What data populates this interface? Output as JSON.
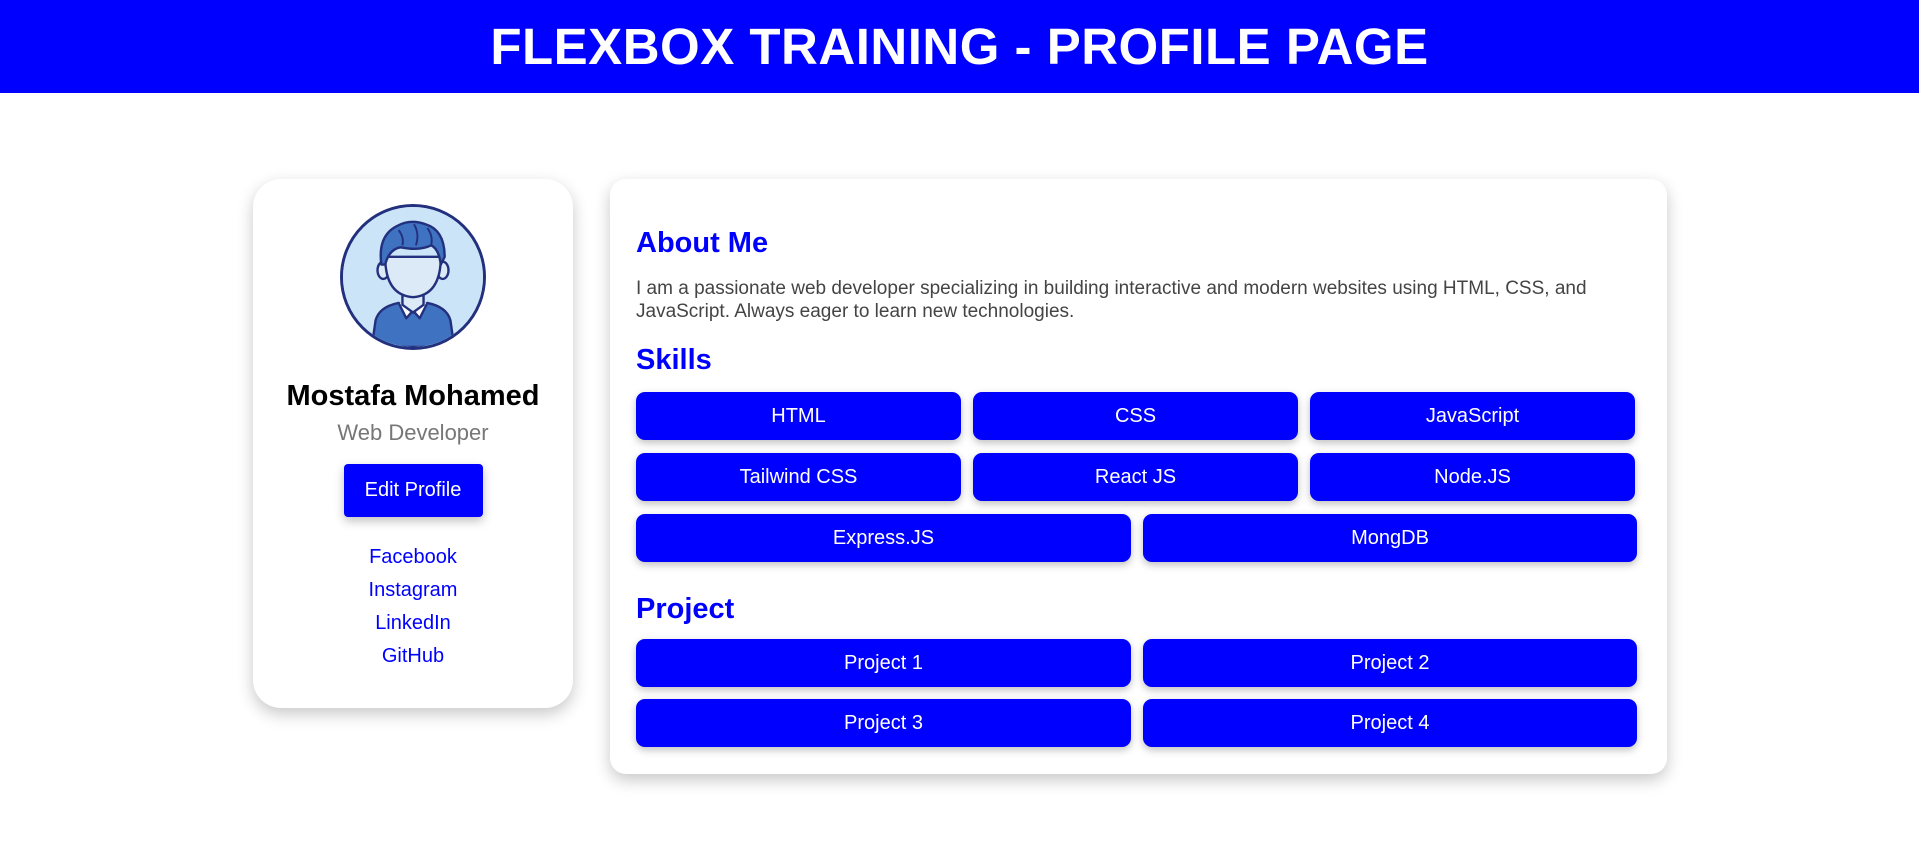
{
  "header": {
    "title": "FLEXBOX TRAINING - PROFILE PAGE"
  },
  "profile": {
    "name": "Mostafa Mohamed",
    "role": "Web Developer",
    "edit_button": "Edit Profile",
    "avatar_icon": "user-avatar-icon",
    "social_links": [
      "Facebook",
      "Instagram",
      "LinkedIn",
      "GitHub"
    ]
  },
  "about": {
    "title": "About Me",
    "text": "I am a passionate web developer specializing in building interactive and modern websites using HTML, CSS, and JavaScript. Always eager to learn new technologies."
  },
  "skills": {
    "title": "Skills",
    "items": [
      "HTML",
      "CSS",
      "JavaScript",
      "Tailwind CSS",
      "React JS",
      "Node.JS",
      "Express.JS",
      "MongDB"
    ]
  },
  "projects": {
    "title": "Project",
    "items": [
      "Project 1",
      "Project 2",
      "Project 3",
      "Project 4"
    ]
  },
  "colors": {
    "accent": "#0000ff",
    "avatar_bg": "#cce4f7",
    "avatar_border": "#23307e"
  }
}
